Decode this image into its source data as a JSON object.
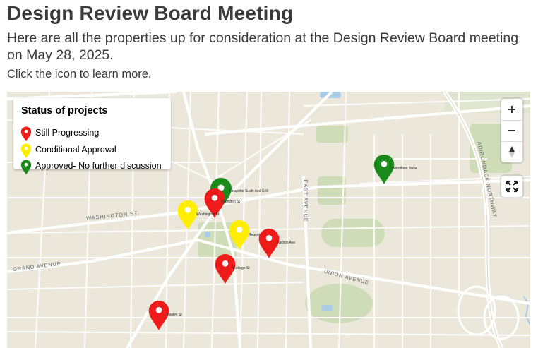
{
  "page": {
    "title": "Design Review Board Meeting",
    "intro": "Here are all the properties up for consideration at the Design Review Board meeting on May 28, 2025.",
    "hint": "Click the icon to learn more."
  },
  "legend": {
    "title": "Status of projects",
    "items": [
      {
        "label": "Still Progressing",
        "color": "#ee1b1b"
      },
      {
        "label": "Conditional Approval",
        "color": "#ffee00"
      },
      {
        "label": "Approved- No further discussion",
        "color": "#1a8a1a"
      }
    ]
  },
  "controls": {
    "zoom_in": "+",
    "zoom_out": "−",
    "compass_icon": "compass-icon",
    "fullscreen_icon": "fullscreen-icon"
  },
  "streets": {
    "washington": "WASHINGTON ST.",
    "grand": "GRAND AVENUE",
    "east": "EAST AVENUE",
    "union": "UNION AVENUE",
    "adirondack": "ADIRONDACK NORTHWAY"
  },
  "markers": [
    {
      "status": "approved",
      "color": "#1a8a1a",
      "label": "Lafayette Sushi And Grill"
    },
    {
      "status": "approved",
      "color": "#1a8a1a",
      "label": "Woodland Drive"
    },
    {
      "status": "progressing",
      "color": "#ee1b1b",
      "label": "Hamilton St"
    },
    {
      "status": "conditional",
      "color": "#ffee00",
      "label": "Washington St"
    },
    {
      "status": "conditional",
      "color": "#ffee00",
      "label": "Regent St"
    },
    {
      "status": "progressing",
      "color": "#ee1b1b",
      "label": "Nelson Ave"
    },
    {
      "status": "progressing",
      "color": "#ee1b1b",
      "label": "Cottage St"
    },
    {
      "status": "progressing",
      "color": "#ee1b1b",
      "label": "Oakley St"
    }
  ]
}
